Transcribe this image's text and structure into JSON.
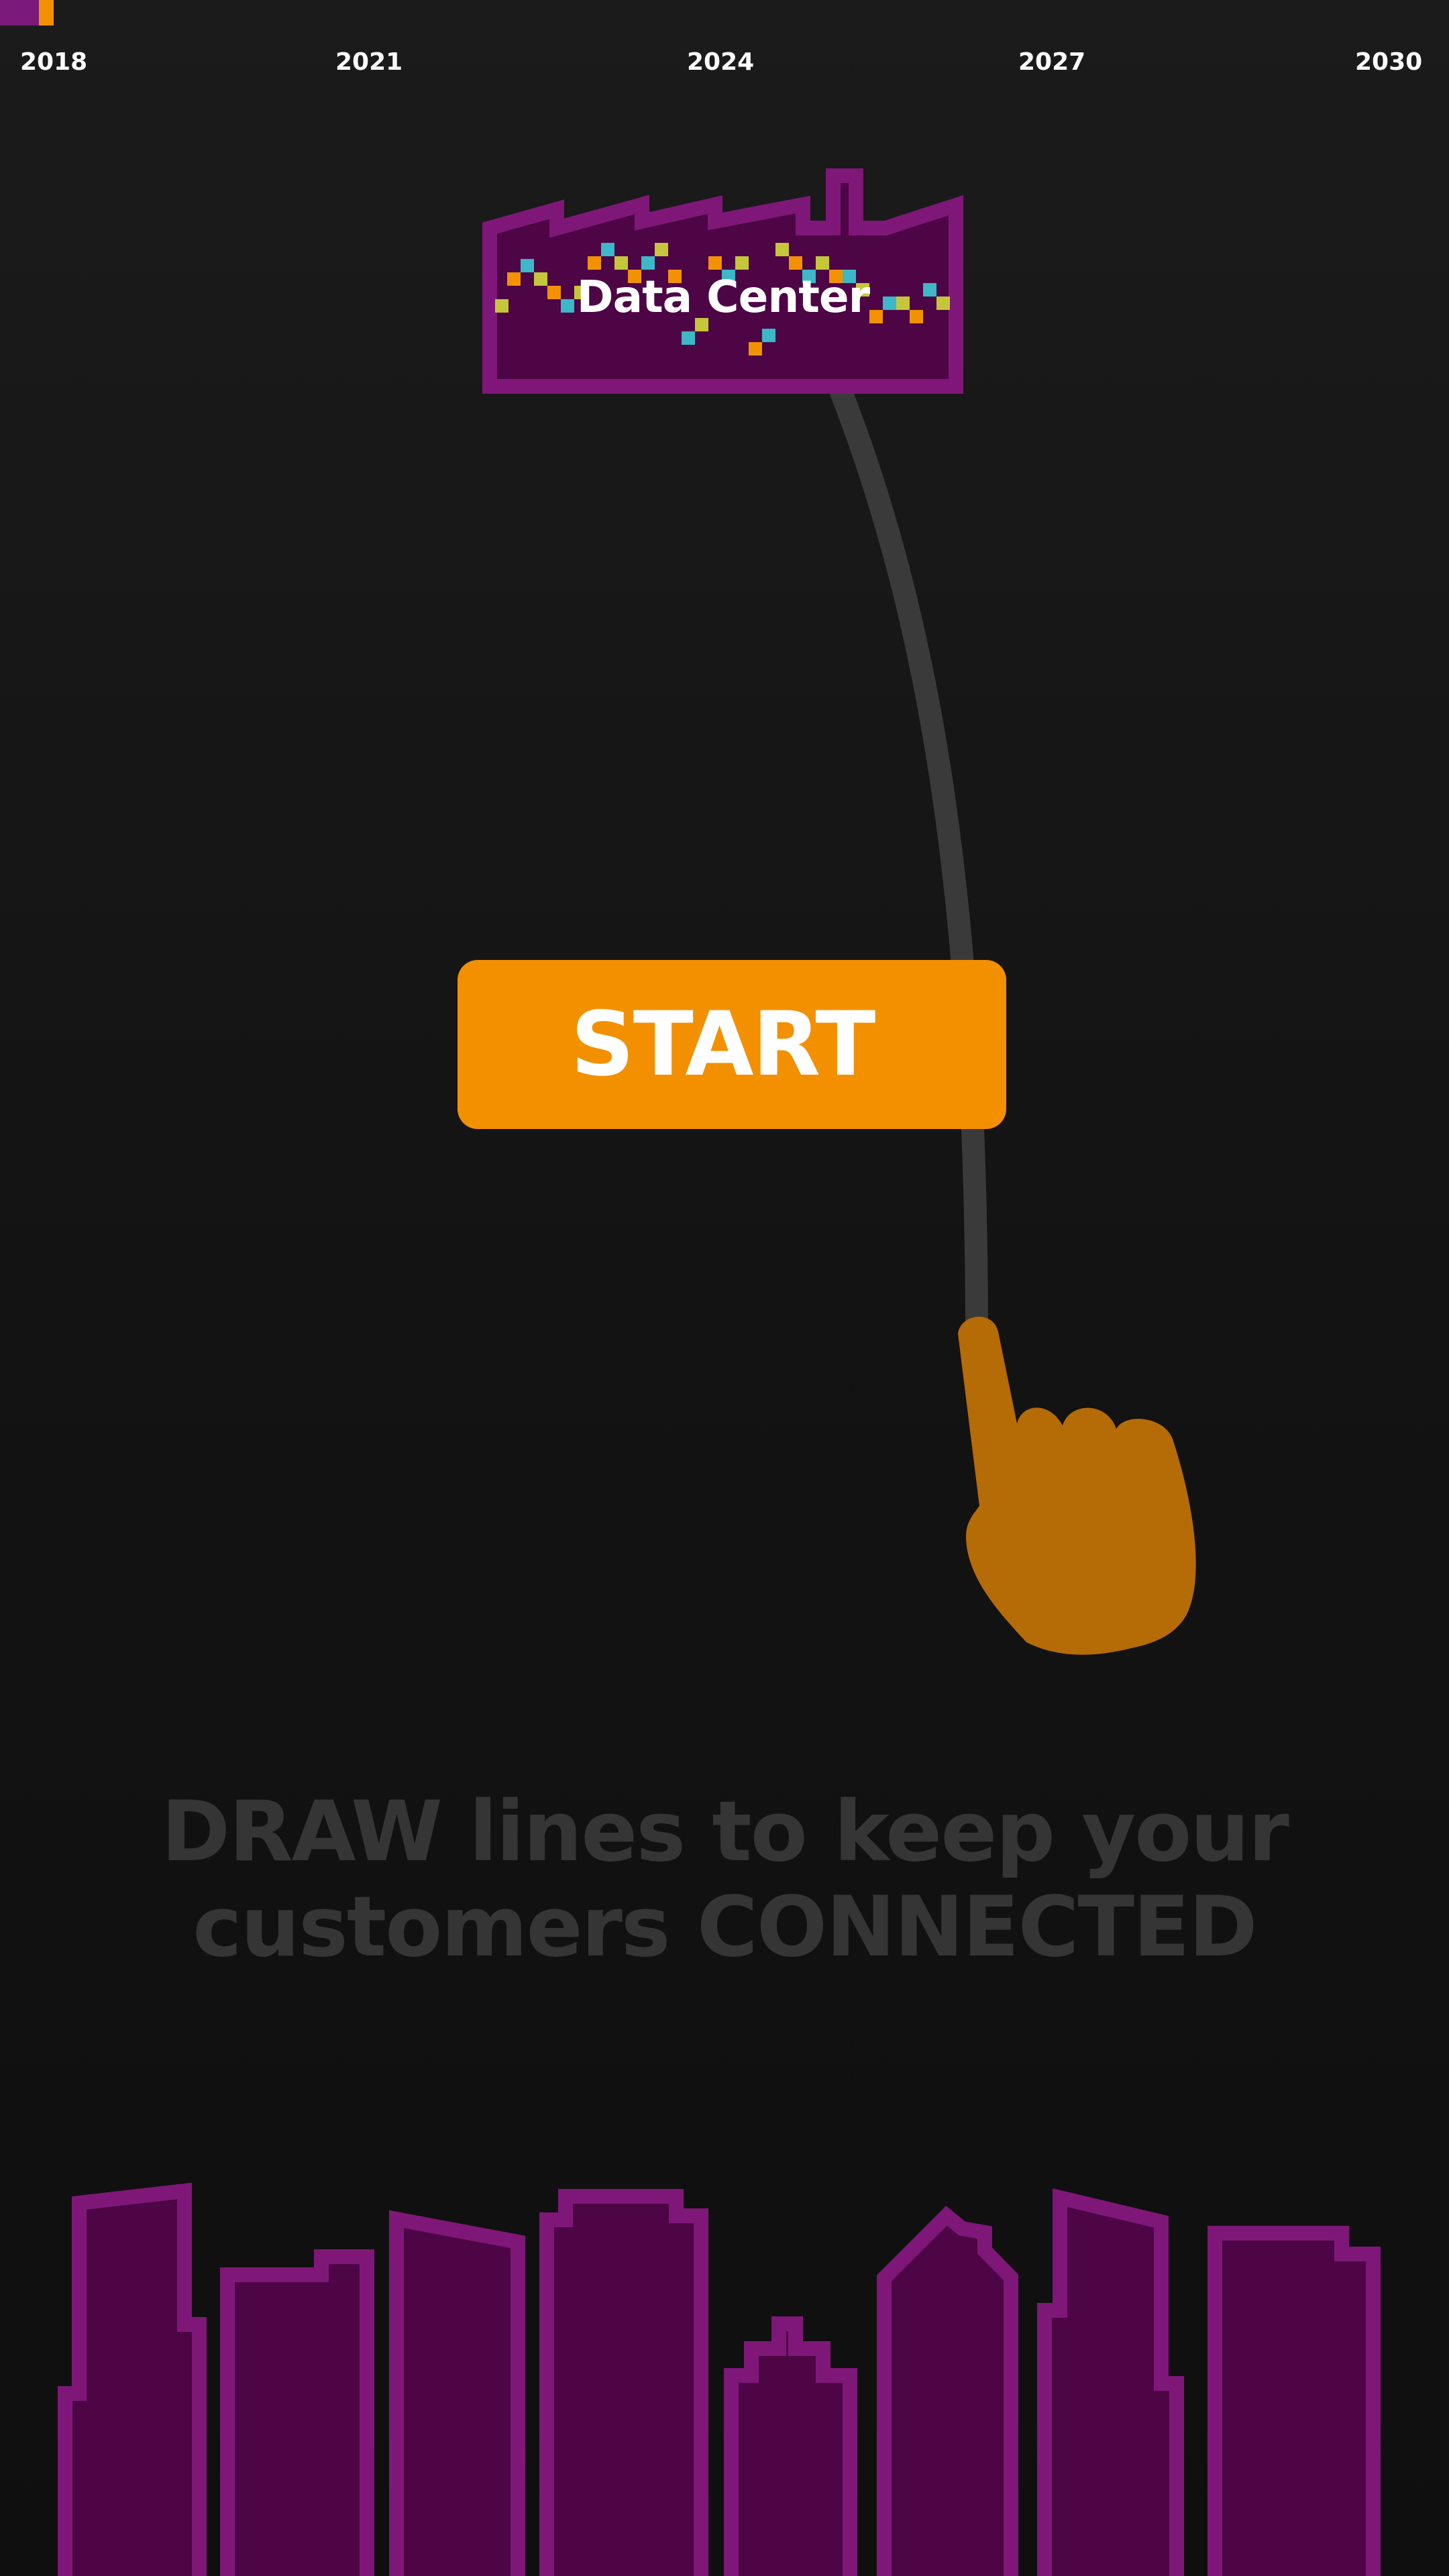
{
  "progress": {
    "fraction": 0.037,
    "colors": {
      "filled": "#7b1a7a",
      "marker": "#f39200"
    }
  },
  "timeline": {
    "years": [
      "2018",
      "2021",
      "2024",
      "2027",
      "2030"
    ]
  },
  "data_center": {
    "label": "Data Center",
    "icon": "factory-icon"
  },
  "start_button": {
    "label": "START",
    "color": "#f39000"
  },
  "pointer": {
    "icon": "pointing-hand-icon",
    "color": "#b56b06"
  },
  "instructions": {
    "line1": "DRAW lines to keep your",
    "line2": "customers CONNECTED"
  },
  "skyline": {
    "icon": "city-skyline-icon",
    "colors": {
      "outline": "#7f1778",
      "fill": "#4d0545"
    }
  }
}
